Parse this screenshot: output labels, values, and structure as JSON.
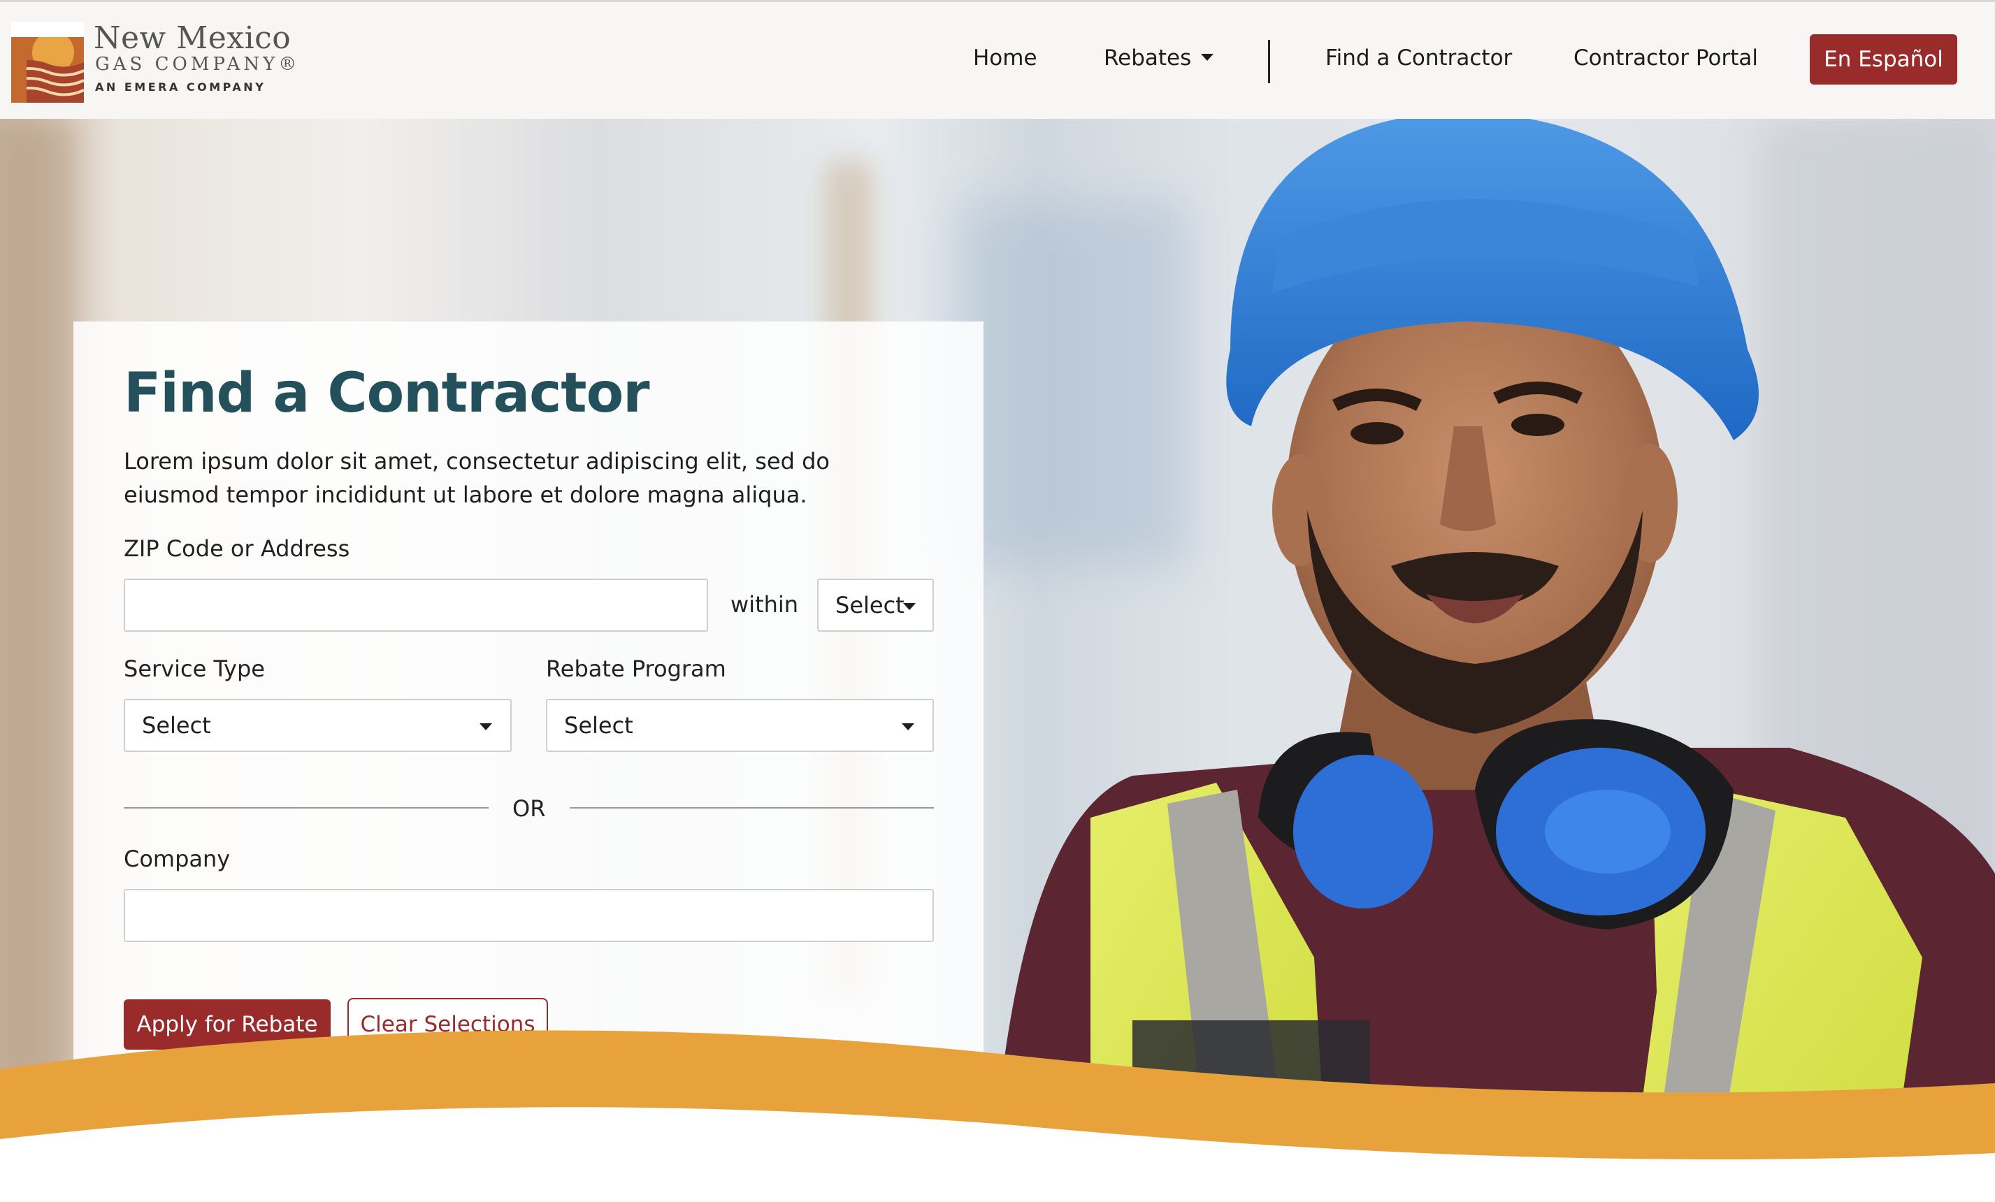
{
  "header": {
    "logo": {
      "line1": "New Mexico",
      "line2": "GAS COMPANY®",
      "line3": "AN EMERA COMPANY"
    },
    "nav": {
      "home": "Home",
      "rebates": "Rebates",
      "find_contractor": "Find a Contractor",
      "contractor_portal": "Contractor Portal"
    },
    "language_button": "En Español"
  },
  "form": {
    "title": "Find a Contractor",
    "description": "Lorem ipsum dolor sit amet, consectetur adipiscing elit, sed do eiusmod tempor incididunt ut labore et dolore magna aliqua.",
    "zip_label": "ZIP Code or Address",
    "zip_value": "",
    "within_label": "within",
    "within_select": "Select",
    "service_type_label": "Service Type",
    "service_type_select": "Select",
    "rebate_program_label": "Rebate Program",
    "rebate_program_select": "Select",
    "or_text": "OR",
    "company_label": "Company",
    "company_value": "",
    "apply_button": "Apply for Rebate",
    "clear_button": "Clear Selections"
  },
  "colors": {
    "brand_red": "#9a2b2b",
    "title_teal": "#24505c",
    "wave_orange": "#e7a23b",
    "header_bg": "#f7f6f4"
  },
  "hero_image": "construction-worker-photo"
}
